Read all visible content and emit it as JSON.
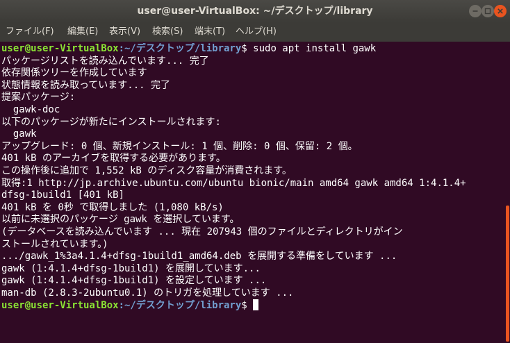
{
  "window": {
    "title": "user@user-VirtualBox: ~/デスクトップ/library",
    "close_color": "#e9541f"
  },
  "menu": {
    "items": [
      "ファイル(F)",
      "編集(E)",
      "表示(V)",
      "検索(S)",
      "端末(T)",
      "ヘルプ(H)"
    ]
  },
  "prompt": {
    "user_host": "user@user-VirtualBox",
    "path": ":~/デスクトップ/library",
    "symbol": "$",
    "user_color": "#8ae234",
    "path_color": "#729fcf"
  },
  "terminal": {
    "command": " sudo apt install gawk",
    "output": [
      "パッケージリストを読み込んでいます... 完了",
      "依存関係ツリーを作成しています",
      "状態情報を読み取っています... 完了",
      "提案パッケージ:",
      "  gawk-doc",
      "以下のパッケージが新たにインストールされます:",
      "  gawk",
      "アップグレード: 0 個、新規インストール: 1 個、削除: 0 個、保留: 2 個。",
      "401 kB のアーカイブを取得する必要があります。",
      "この操作後に追加で 1,552 kB のディスク容量が消費されます。",
      "取得:1 http://jp.archive.ubuntu.com/ubuntu bionic/main amd64 gawk amd64 1:4.1.4+",
      "dfsg-1build1 [401 kB]",
      "401 kB を 0秒 で取得しました (1,080 kB/s)",
      "以前に未選択のパッケージ gawk を選択しています。",
      "(データベースを読み込んでいます ... 現在 207943 個のファイルとディレクトリがイン",
      "ストールされています。)",
      ".../gawk_1%3a4.1.4+dfsg-1build1_amd64.deb を展開する準備をしています ...",
      "gawk (1:4.1.4+dfsg-1build1) を展開しています...",
      "gawk (1:4.1.4+dfsg-1build1) を設定しています ...",
      "man-db (2.8.3-2ubuntu0.1) のトリガを処理しています ..."
    ],
    "final_input": " "
  }
}
